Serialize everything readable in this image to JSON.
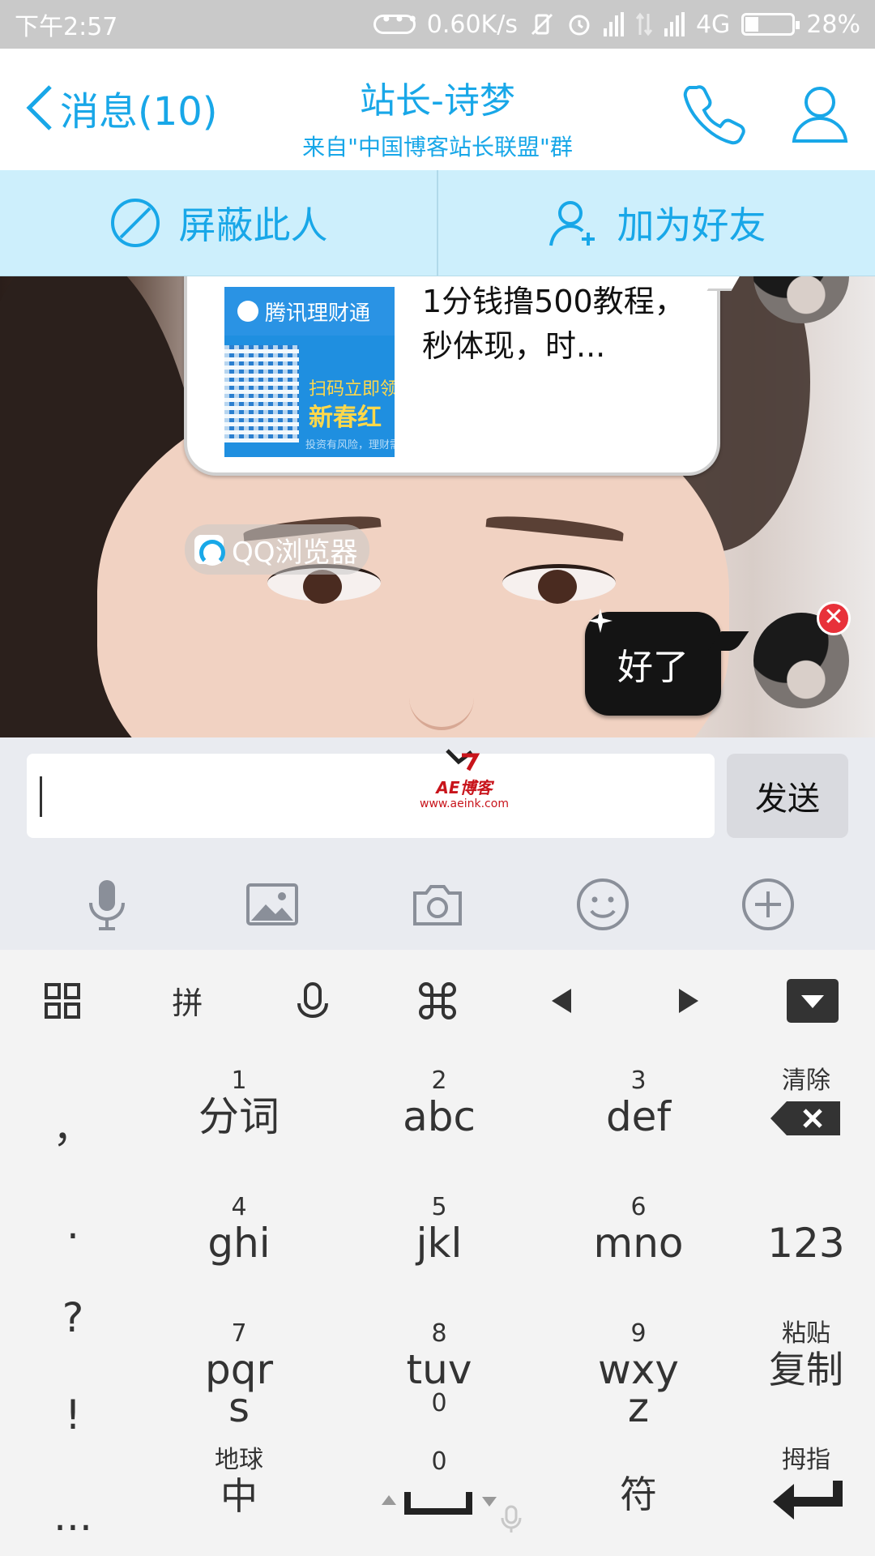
{
  "status_bar": {
    "time": "下午2:57",
    "speed": "0.60K/s",
    "network": "4G",
    "battery": "28%"
  },
  "header": {
    "back_label": "消息(10)",
    "title": "站长-诗梦",
    "subtitle": "来自\"中国博客站长联盟\"群"
  },
  "actions": {
    "block": "屏蔽此人",
    "add_friend": "加为好友"
  },
  "chat": {
    "card_text": "1分钱撸500教程，秒体现，时...",
    "card_thumb": {
      "brand": "腾讯理财通",
      "line1": "扫码立即领",
      "line2": "新春红",
      "line3": "投资有风险，理财需"
    },
    "browser_tag": "QQ浏览器",
    "message": "好了",
    "error_badge": "✕"
  },
  "input": {
    "value": "",
    "send_label": "发送",
    "watermark_name": "AE博客",
    "watermark_url": "www.aeink.com"
  },
  "tools": [
    "microphone-icon",
    "image-icon",
    "camera-icon",
    "emoji-icon",
    "plus-icon"
  ],
  "keyboard": {
    "top_row": {
      "pinyin": "拼"
    },
    "punctuation": [
      "，",
      ".",
      "?",
      "!",
      "..."
    ],
    "keys": [
      {
        "num": "1",
        "main": "分词"
      },
      {
        "num": "2",
        "main": "abc"
      },
      {
        "num": "3",
        "main": "def"
      },
      {
        "num": "4",
        "main": "ghi"
      },
      {
        "num": "5",
        "main": "jkl"
      },
      {
        "num": "6",
        "main": "mno"
      },
      {
        "num": "7",
        "main": "pqr",
        "sub": "s"
      },
      {
        "num": "8",
        "main": "tuv",
        "sub": "0"
      },
      {
        "num": "9",
        "main": "wxy",
        "sub": "z"
      }
    ],
    "clear_label": "清除",
    "num_label": "123",
    "paste_label": "粘贴",
    "copy_label": "复制",
    "globe_label": "地球",
    "lang_label": "中",
    "space_num": "0",
    "symbol_label": "符",
    "thumb_label": "拇指"
  }
}
